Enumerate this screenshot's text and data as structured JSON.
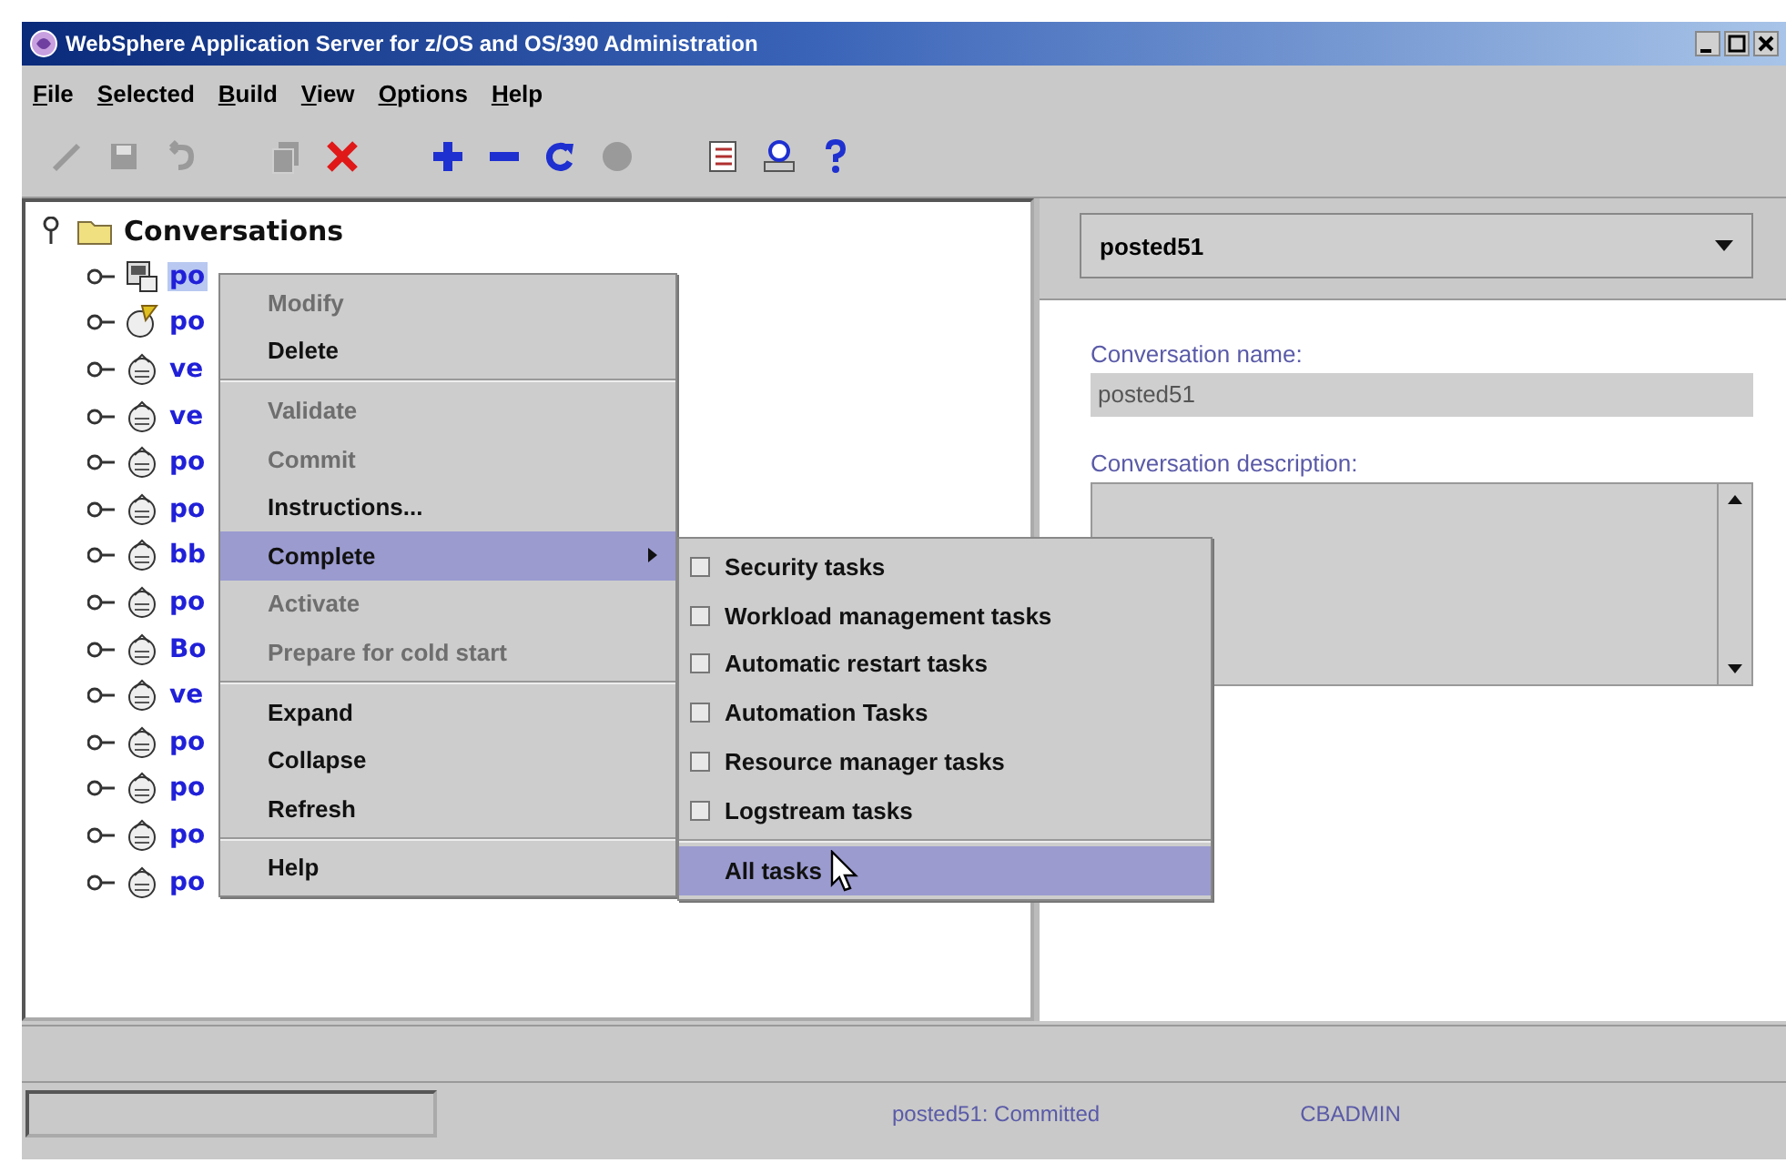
{
  "window": {
    "title": "WebSphere Application Server for z/OS and OS/390 Administration"
  },
  "menu_bar": [
    "File",
    "Selected",
    "Build",
    "View",
    "Options",
    "Help"
  ],
  "toolbar": [
    {
      "kind": "pencil",
      "disabled": true
    },
    {
      "kind": "save",
      "disabled": true
    },
    {
      "kind": "undo",
      "disabled": true
    },
    {
      "kind": "separator"
    },
    {
      "kind": "copy",
      "disabled": true
    },
    {
      "kind": "delete",
      "disabled": false
    },
    {
      "kind": "separator"
    },
    {
      "kind": "add",
      "disabled": false
    },
    {
      "kind": "remove",
      "disabled": false
    },
    {
      "kind": "refresh",
      "disabled": false
    },
    {
      "kind": "stop",
      "disabled": true
    },
    {
      "kind": "separator"
    },
    {
      "kind": "list",
      "disabled": false
    },
    {
      "kind": "properties",
      "disabled": false
    },
    {
      "kind": "help",
      "disabled": false
    }
  ],
  "tree": {
    "label": "Conversations",
    "expanded": true,
    "children": [
      {
        "label": "po",
        "kind": "document",
        "selected": true,
        "expanded": false
      },
      {
        "label": "po",
        "kind": "tagged",
        "selected": false,
        "expanded": false
      },
      {
        "label": "ve",
        "kind": "plain",
        "selected": false,
        "expanded": false
      },
      {
        "label": "ve",
        "kind": "plain",
        "selected": false,
        "expanded": false
      },
      {
        "label": "po",
        "kind": "plain",
        "selected": false,
        "expanded": false
      },
      {
        "label": "po",
        "kind": "plain",
        "selected": false,
        "expanded": false
      },
      {
        "label": "bb",
        "kind": "plain",
        "selected": false,
        "expanded": false
      },
      {
        "label": "po",
        "kind": "plain",
        "selected": false,
        "expanded": false
      },
      {
        "label": "Bo",
        "kind": "plain",
        "selected": false,
        "expanded": false
      },
      {
        "label": "ve",
        "kind": "plain",
        "selected": false,
        "expanded": false
      },
      {
        "label": "po",
        "kind": "plain",
        "selected": false,
        "expanded": false
      },
      {
        "label": "po",
        "kind": "plain",
        "selected": false,
        "expanded": false
      },
      {
        "label": "po",
        "kind": "plain",
        "selected": false,
        "expanded": false
      },
      {
        "label": "po",
        "kind": "plain",
        "selected": false,
        "expanded": false
      }
    ]
  },
  "context_menu": {
    "items": [
      {
        "kind": "item",
        "label": "Modify",
        "disabled": true,
        "selected": false
      },
      {
        "kind": "item",
        "label": "Delete",
        "disabled": false,
        "selected": false
      },
      {
        "kind": "separator"
      },
      {
        "kind": "item",
        "label": "Validate",
        "disabled": true,
        "selected": false
      },
      {
        "kind": "item",
        "label": "Commit",
        "disabled": true,
        "selected": false
      },
      {
        "kind": "item",
        "label": "Instructions...",
        "disabled": false,
        "selected": false
      },
      {
        "kind": "submenu",
        "label": "Complete",
        "disabled": false,
        "selected": true
      },
      {
        "kind": "item",
        "label": "Activate",
        "disabled": true,
        "selected": false
      },
      {
        "kind": "item",
        "label": "Prepare for cold start",
        "disabled": true,
        "selected": false
      },
      {
        "kind": "separator"
      },
      {
        "kind": "item",
        "label": "Expand",
        "disabled": false,
        "selected": false
      },
      {
        "kind": "item",
        "label": "Collapse",
        "disabled": false,
        "selected": false
      },
      {
        "kind": "item",
        "label": "Refresh",
        "disabled": false,
        "selected": false
      },
      {
        "kind": "separator"
      },
      {
        "kind": "item",
        "label": "Help",
        "disabled": false,
        "selected": false
      }
    ]
  },
  "submenu": {
    "items": [
      {
        "kind": "check",
        "label": "Security tasks",
        "checked": false,
        "selected": false
      },
      {
        "kind": "check",
        "label": "Workload management tasks",
        "checked": false,
        "selected": false
      },
      {
        "kind": "check",
        "label": "Automatic restart tasks",
        "checked": false,
        "selected": false
      },
      {
        "kind": "check",
        "label": "Automation Tasks",
        "checked": false,
        "selected": false
      },
      {
        "kind": "check",
        "label": "Resource manager tasks",
        "checked": false,
        "selected": false
      },
      {
        "kind": "check",
        "label": "Logstream tasks",
        "checked": false,
        "selected": false
      },
      {
        "kind": "separator"
      },
      {
        "kind": "item",
        "label": "All tasks",
        "selected": true
      }
    ]
  },
  "details": {
    "dropdown": {
      "value": "posted51"
    },
    "fields": [
      {
        "kind": "text",
        "label": "Conversation name:",
        "value": "posted51"
      },
      {
        "kind": "textarea",
        "label": "Conversation description:"
      }
    ]
  },
  "status_bar": {
    "message": "posted51: Committed",
    "user": "CBADMIN"
  }
}
